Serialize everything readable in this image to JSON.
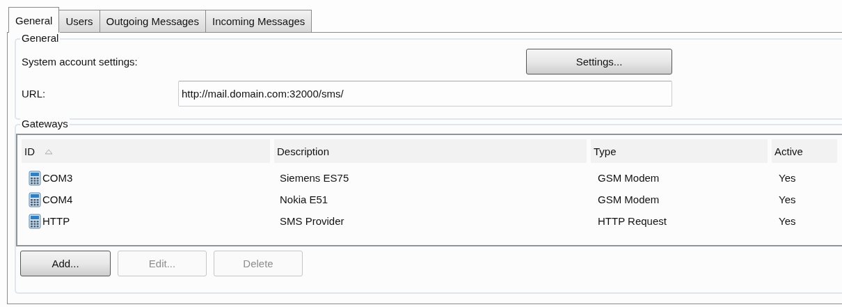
{
  "tabs": [
    {
      "label": "General",
      "selected": true
    },
    {
      "label": "Users",
      "selected": false
    },
    {
      "label": "Outgoing Messages",
      "selected": false
    },
    {
      "label": "Incoming Messages",
      "selected": false
    }
  ],
  "general": {
    "title": "General",
    "system_account_label": "System account settings:",
    "settings_button": "Settings...",
    "url_label": "URL:",
    "url_value": "http://mail.domain.com:32000/sms/"
  },
  "gateways": {
    "title": "Gateways",
    "columns": [
      {
        "label": "ID",
        "sorted": true
      },
      {
        "label": "Description",
        "sorted": false
      },
      {
        "label": "Type",
        "sorted": false
      },
      {
        "label": "Active",
        "sorted": false
      }
    ],
    "rows": [
      {
        "cells": [
          "COM3",
          "Siemens ES75",
          "GSM Modem",
          "Yes"
        ]
      },
      {
        "cells": [
          "COM4",
          "Nokia E51",
          "GSM Modem",
          "Yes"
        ]
      },
      {
        "cells": [
          "HTTP",
          "SMS Provider",
          "HTTP Request",
          "Yes"
        ]
      }
    ],
    "buttons": [
      {
        "label": "Add...",
        "disabled": false
      },
      {
        "label": "Edit...",
        "disabled": true
      },
      {
        "label": "Delete",
        "disabled": true
      }
    ]
  }
}
